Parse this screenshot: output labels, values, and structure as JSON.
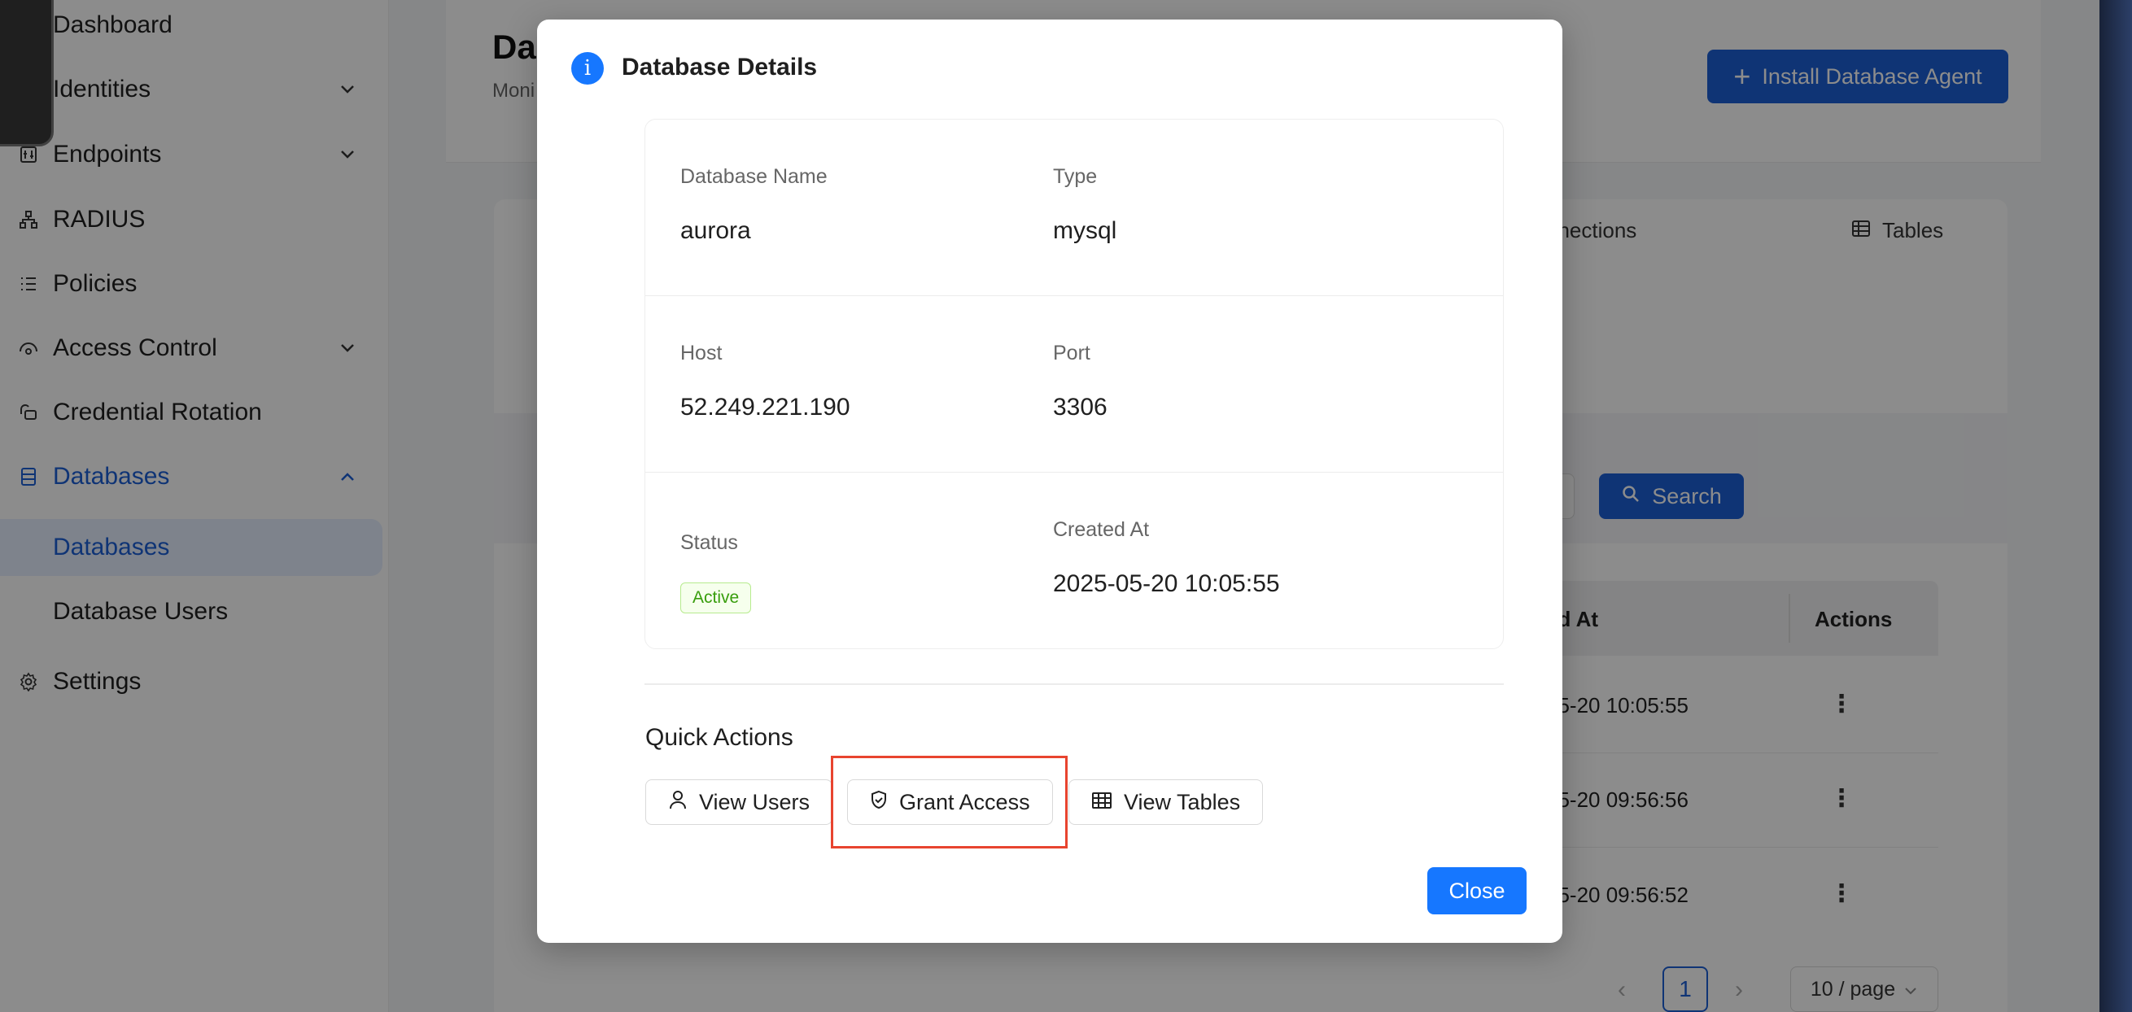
{
  "sidebar": {
    "items": [
      {
        "label": "Dashboard",
        "icon": "dashboard-icon"
      },
      {
        "label": "Identities",
        "icon": "identities-icon"
      },
      {
        "label": "Endpoints",
        "icon": "endpoints-icon"
      },
      {
        "label": "RADIUS",
        "icon": "radius-icon"
      },
      {
        "label": "Policies",
        "icon": "policies-icon"
      },
      {
        "label": "Access Control",
        "icon": "access-control-icon"
      },
      {
        "label": "Credential Rotation",
        "icon": "credential-rotation-icon"
      },
      {
        "label": "Databases",
        "icon": "database-icon"
      },
      {
        "label": "Settings",
        "icon": "gear-icon"
      }
    ],
    "sub_items": [
      {
        "label": "Databases",
        "selected": true
      },
      {
        "label": "Database Users",
        "selected": false
      }
    ]
  },
  "page": {
    "title": "Da",
    "subtitle": "Moni",
    "install_button": "Install Database Agent"
  },
  "background": {
    "tabs": {
      "connections": "nnections",
      "tables": "Tables"
    },
    "search_button": "Search",
    "table": {
      "headers": {
        "created": "ed At",
        "actions": "Actions"
      },
      "rows": [
        {
          "created": "05-20 10:05:55",
          "actions": "⋮"
        },
        {
          "created": "05-20 09:56:56",
          "actions": "⋮"
        },
        {
          "created": "05-20 09:56:52",
          "actions": "⋮"
        }
      ]
    },
    "pagination": {
      "prev": "‹",
      "current": "1",
      "next": "›",
      "page_size": "10 / page"
    }
  },
  "modal": {
    "title": "Database Details",
    "fields": {
      "database_name": {
        "label": "Database Name",
        "value": "aurora"
      },
      "type": {
        "label": "Type",
        "value": "mysql"
      },
      "host": {
        "label": "Host",
        "value": "52.249.221.190"
      },
      "port": {
        "label": "Port",
        "value": "3306"
      },
      "status": {
        "label": "Status",
        "value": "Active"
      },
      "created_at": {
        "label": "Created At",
        "value": "2025-05-20 10:05:55"
      }
    },
    "quick_actions": {
      "title": "Quick Actions",
      "view_users": "View Users",
      "grant_access": "Grant Access",
      "view_tables": "View Tables"
    },
    "close_button": "Close"
  },
  "colors": {
    "primary": "#1677ff",
    "nav_active": "#1d5fd6",
    "status_active": "#389e0d",
    "highlight": "#e8442f"
  }
}
